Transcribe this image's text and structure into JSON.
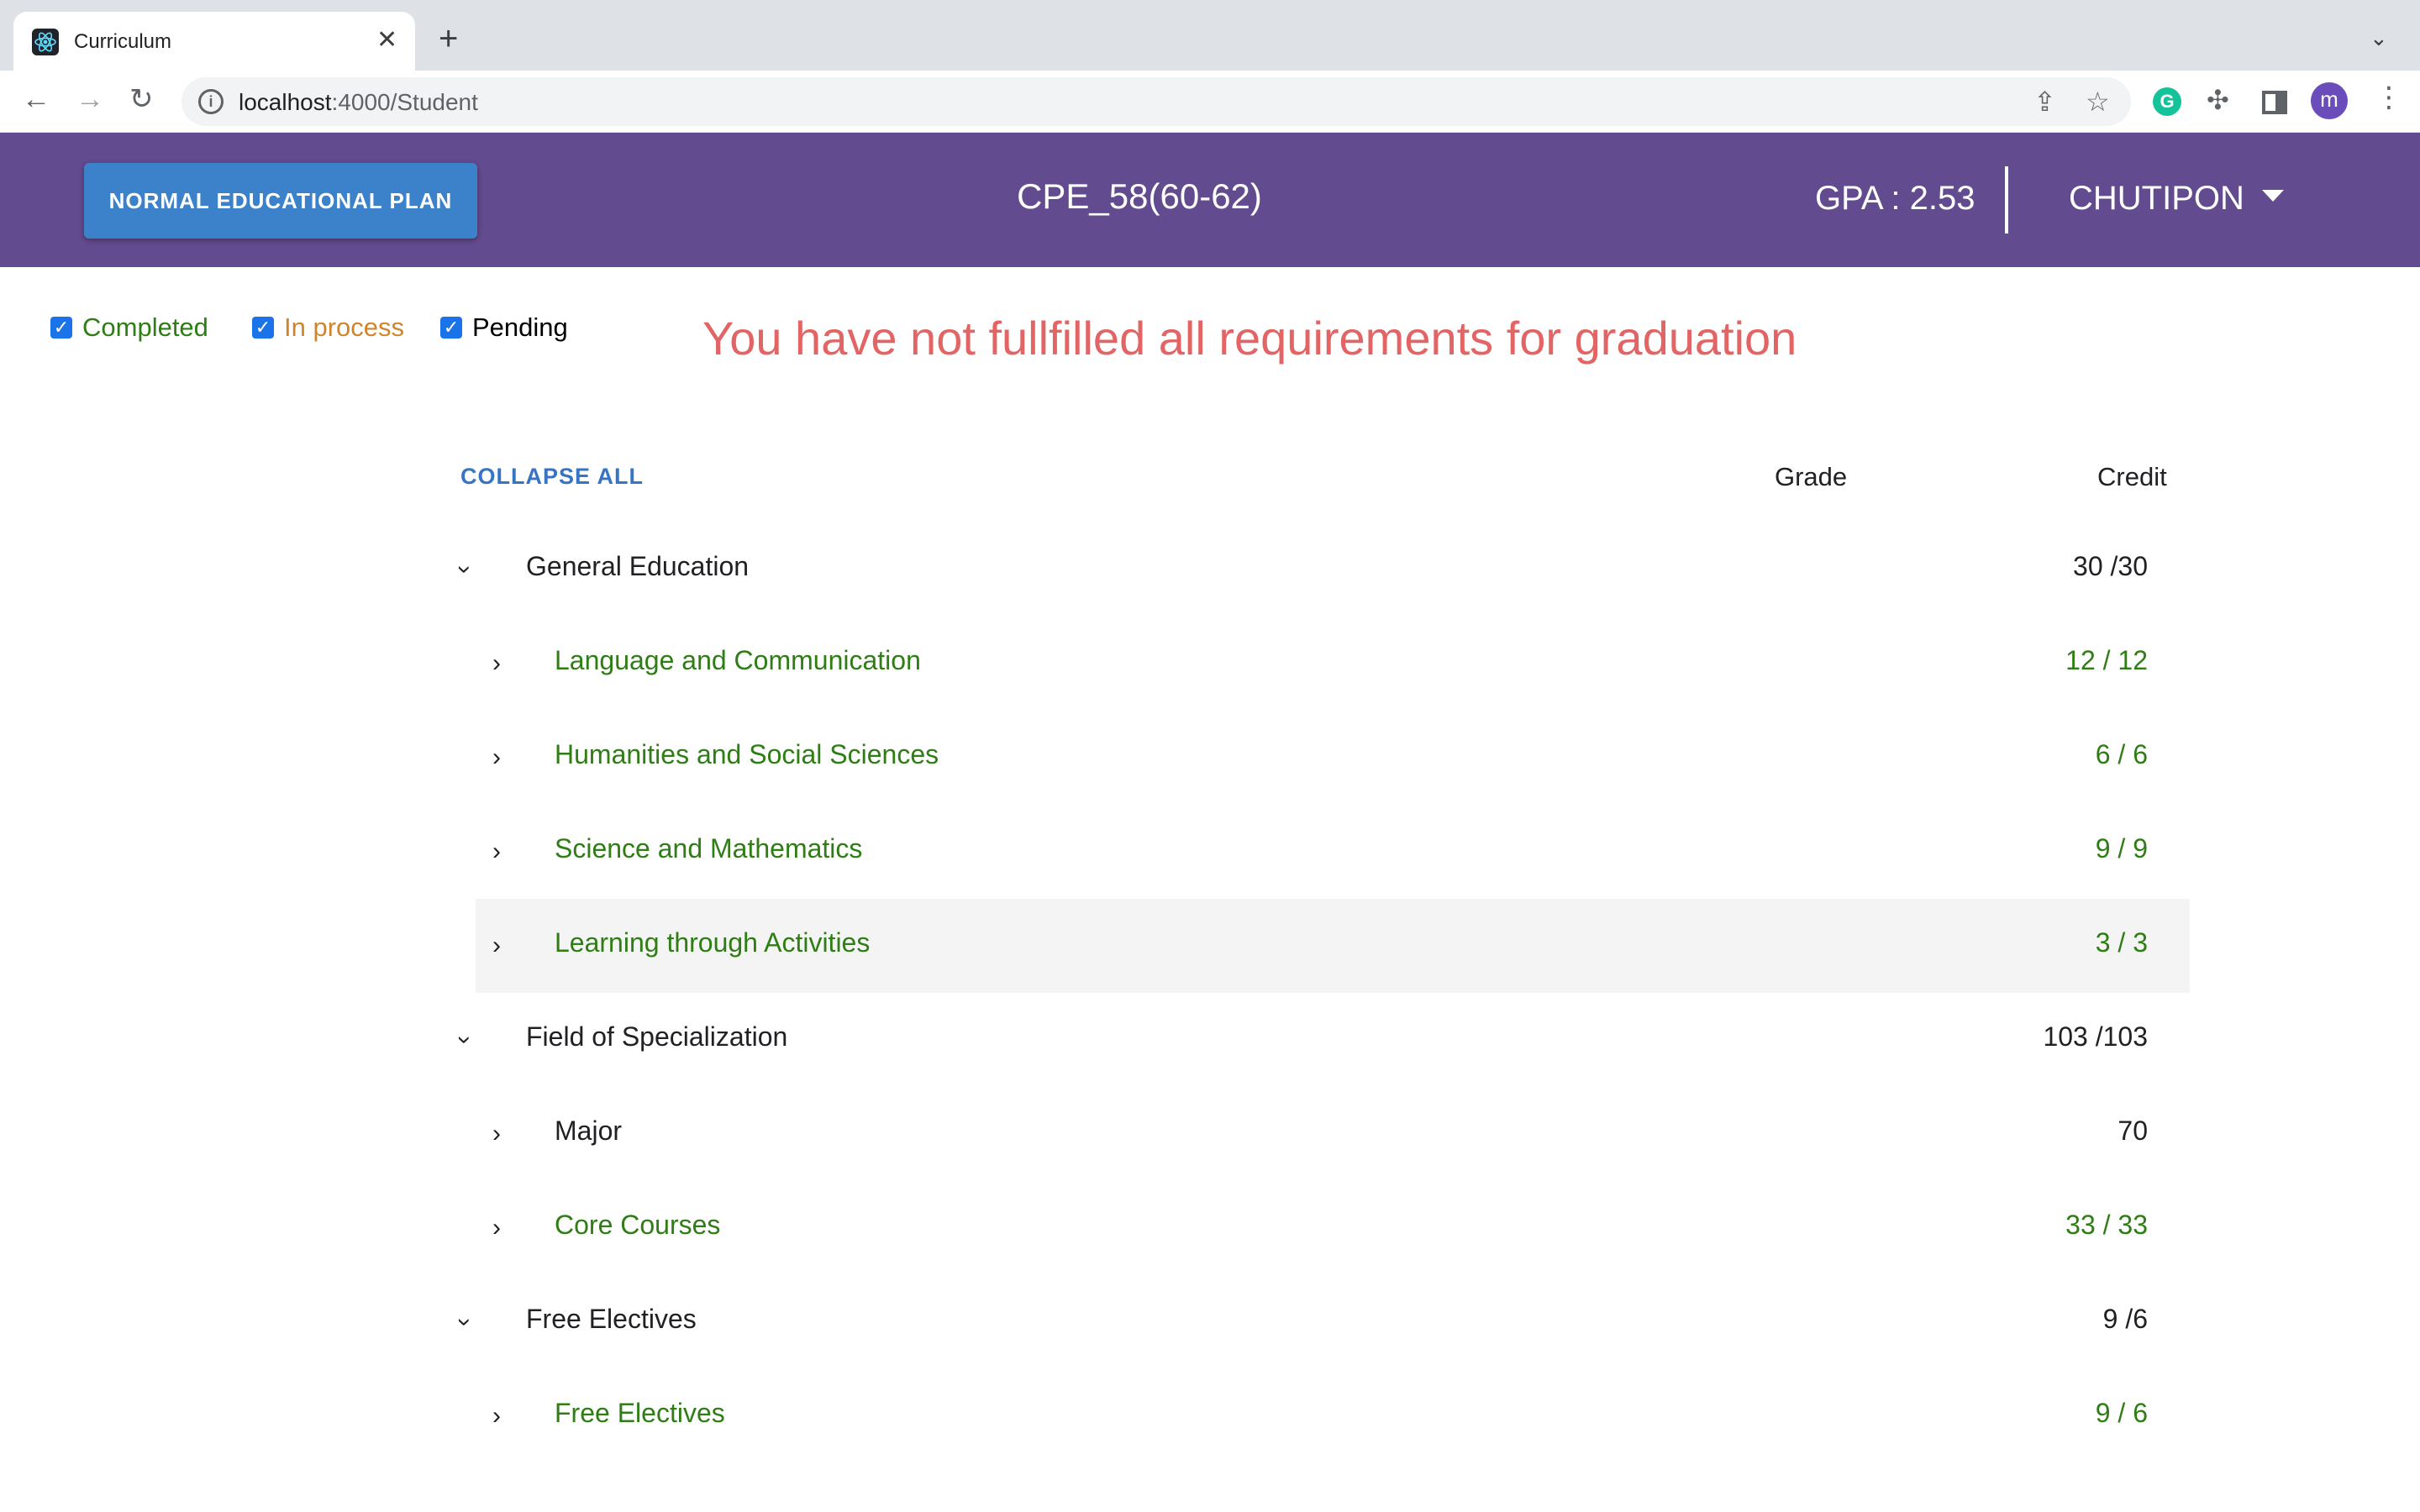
{
  "browser": {
    "tab_title": "Curriculum",
    "url_host": "localhost",
    "url_rest": ":4000/Student",
    "profile_initial": "m",
    "extension_initial": "G"
  },
  "header": {
    "plan_button": "NORMAL EDUCATIONAL PLAN",
    "curriculum": "CPE_58(60-62)",
    "gpa": "GPA : 2.53",
    "user": "CHUTIPON"
  },
  "filters": {
    "completed": "Completed",
    "in_process": "In process",
    "pending": "Pending"
  },
  "warning": "You have not fullfilled all requirements for graduation",
  "table": {
    "collapse_all": "COLLAPSE ALL",
    "grade_header": "Grade",
    "credit_header": "Credit",
    "rows": [
      {
        "label": "General Education",
        "credit": "30 /30"
      },
      {
        "label": "Language and Communication",
        "credit": "12 / 12"
      },
      {
        "label": "Humanities and Social Sciences",
        "credit": "6 / 6"
      },
      {
        "label": "Science and Mathematics",
        "credit": "9 / 9"
      },
      {
        "label": "Learning through Activities",
        "credit": "3 / 3"
      },
      {
        "label": "Field of Specialization",
        "credit": "103 /103"
      },
      {
        "label": "Major",
        "credit": "70"
      },
      {
        "label": "Core Courses",
        "credit": "33 / 33"
      },
      {
        "label": "Free Electives",
        "credit": "9 /6"
      },
      {
        "label": "Free Electives",
        "credit": "9 / 6"
      }
    ]
  },
  "colors": {
    "header_bg": "#624b8e",
    "plan_button": "#3c82ca",
    "completed_green": "#2e7d15",
    "in_process_orange": "#d0852a",
    "warning_red": "#e36464",
    "link_blue": "#3674c4"
  }
}
